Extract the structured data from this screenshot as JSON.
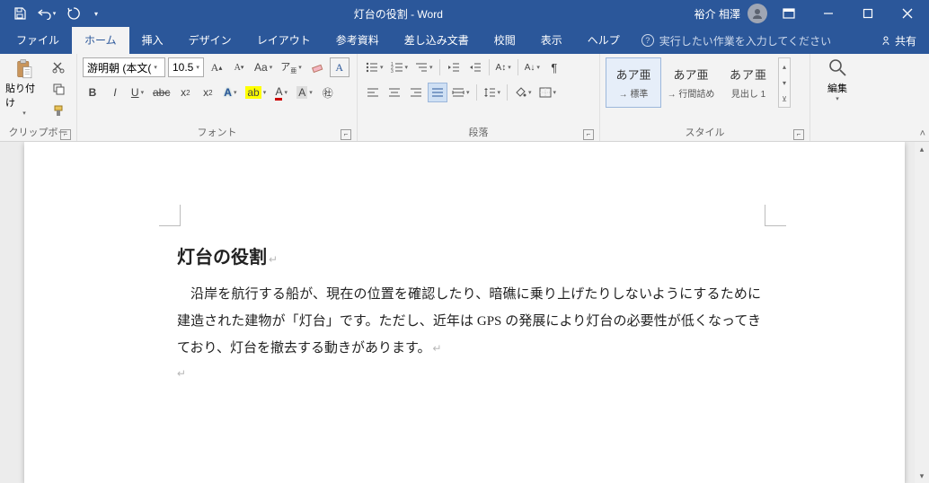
{
  "titlebar": {
    "title": "灯台の役割 - Word",
    "user_name": "裕介 相澤"
  },
  "tabs": {
    "file": "ファイル",
    "home": "ホーム",
    "insert": "挿入",
    "design": "デザイン",
    "layout": "レイアウト",
    "references": "参考資料",
    "mailings": "差し込み文書",
    "review": "校閲",
    "view": "表示",
    "help": "ヘルプ",
    "tellme": "実行したい作業を入力してください",
    "share": "共有"
  },
  "ribbon": {
    "clipboard": {
      "label": "クリップボード",
      "paste": "貼り付け"
    },
    "font": {
      "label": "フォント",
      "name": "游明朝 (本文(",
      "size": "10.5"
    },
    "paragraph": {
      "label": "段落"
    },
    "styles": {
      "label": "スタイル",
      "items": [
        {
          "preview": "あア亜",
          "name": "→ 標準"
        },
        {
          "preview": "あア亜",
          "name": "→ 行間詰め"
        },
        {
          "preview": "あア亜",
          "name": "見出し 1"
        }
      ]
    },
    "editing": {
      "label": "編集"
    }
  },
  "document": {
    "heading": "灯台の役割",
    "body": "沿岸を航行する船が、現在の位置を確認したり、暗礁に乗り上げたりしないようにするために建造された建物が「灯台」です。ただし、近年は GPS の発展により灯台の必要性が低くなってきており、灯台を撤去する動きがあります。"
  }
}
